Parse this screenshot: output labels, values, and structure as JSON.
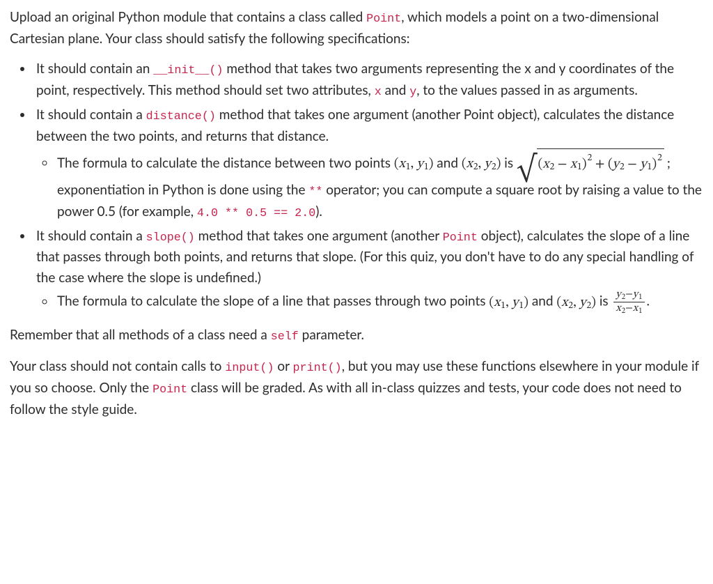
{
  "intro": {
    "t0": "Upload an original Python module that contains a class called ",
    "c0": "Point",
    "t1": ", which models a point on a two-dimensional Cartesian plane. Your class should satisfy the following specifications:"
  },
  "b1": {
    "t0": "It should contain an ",
    "c0": "__init__()",
    "t1": " method that takes two arguments representing the x and y coordinates of the point, respectively. This method should set two attributes, ",
    "c1": "x",
    "t2": " and ",
    "c2": "y",
    "t3": ", to the values passed in as arguments."
  },
  "b2": {
    "t0": "It should contain a ",
    "c0": "distance()",
    "t1": " method that takes one argument (another Point object), calculates the distance between the two points, and returns that distance."
  },
  "b2s": {
    "t0": "The formula to calculate the distance between two points ",
    "t1": " and ",
    "t2": " is ",
    "t3": "; exponentiation in Python is done using the ",
    "c0": "**",
    "t4": " operator; you can compute a square root by raising a value to the power 0.5 (for example, ",
    "c1": "4.0 ** 0.5 == 2.0",
    "t5": ")."
  },
  "b3": {
    "t0": "It should contain a ",
    "c0": "slope()",
    "t1": " method that takes one argument (another ",
    "c1": "Point",
    "t2": " object), calculates the slope of a line that passes through both points, and returns that slope. (For this quiz, you don't have to do any special handling of the case where the slope is undefined.)"
  },
  "b3s": {
    "t0": "The formula to calculate the slope of a line that passes through two points ",
    "t1": " and ",
    "t2": " is ",
    "t3": "."
  },
  "selfnote": {
    "t0": "Remember that all methods of a class need a ",
    "c0": "self",
    "t1": " parameter."
  },
  "footer": {
    "t0": "Your class should not contain calls to ",
    "c0": "input()",
    "t1": " or ",
    "c1": "print()",
    "t2": ", but you may use these functions elsewhere in your module if you so choose. Only the ",
    "c2": "Point",
    "t3": " class will be graded. As with all in-class quizzes and tests, your code does not need to follow the style guide."
  },
  "math": {
    "p1_open": "(",
    "p1_x": "x",
    "p1_xs": "1",
    "p1_sep": ", ",
    "p1_y": "y",
    "p1_ys": "1",
    "p1_close": ")",
    "p2_open": "(",
    "p2_x": "x",
    "p2_xs": "2",
    "p2_sep": ", ",
    "p2_y": "y",
    "p2_ys": "2",
    "p2_close": ")",
    "rad_inner": {
      "a": "(",
      "b": "x",
      "b1": "2",
      "c": " − ",
      "d": "x",
      "d1": "1",
      "e": ")",
      "sq1": "2",
      "plus": " + ",
      "f": "(",
      "g": "y",
      "g1": "2",
      "h": " − ",
      "i": "y",
      "i1": "1",
      "j": ")",
      "sq2": "2"
    },
    "frac": {
      "n1": "y",
      "n1s": "2",
      "nm": "−",
      "n2": "y",
      "n2s": "1",
      "d1": "x",
      "d1s": "2",
      "dm": "−",
      "d2": "x",
      "d2s": "1"
    }
  }
}
